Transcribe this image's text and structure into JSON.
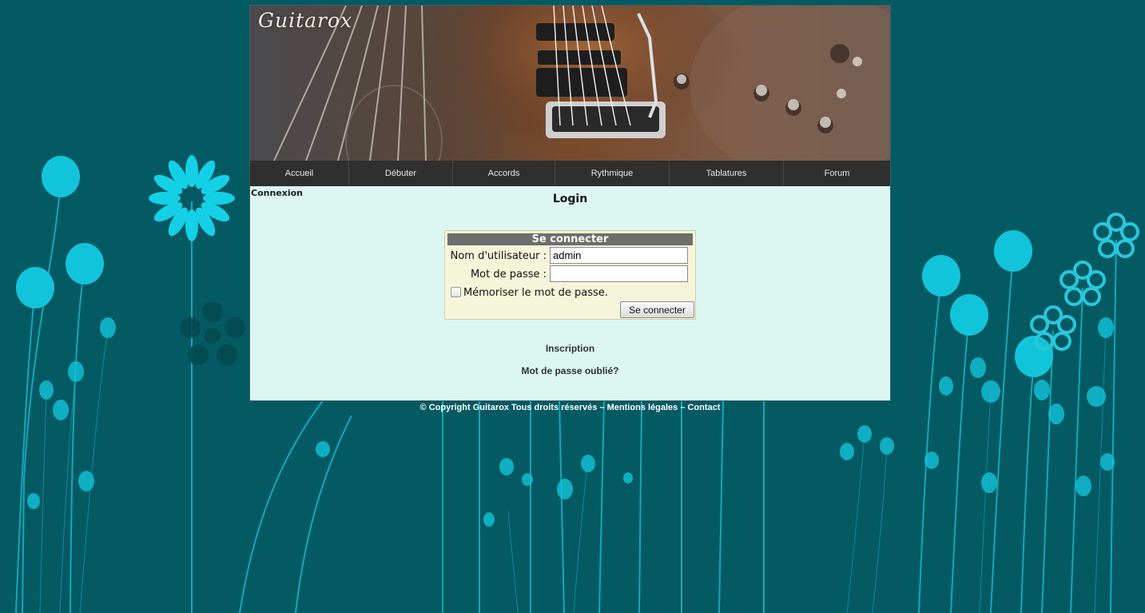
{
  "site": {
    "title": "Guitarox"
  },
  "nav": {
    "items": [
      {
        "label": "Accueil"
      },
      {
        "label": "Débuter"
      },
      {
        "label": "Accords"
      },
      {
        "label": "Rythmique"
      },
      {
        "label": "Tablatures"
      },
      {
        "label": "Forum"
      }
    ]
  },
  "sidebar": {
    "title": "Connexion"
  },
  "main": {
    "title": "Login"
  },
  "login_form": {
    "header": "Se connecter",
    "username_label": "Nom d'utilisateur :",
    "username_value": "admin",
    "password_label": "Mot de passe :",
    "password_value": "",
    "remember_label": "Mémoriser le mot de passe.",
    "remember_checked": false,
    "submit_label": "Se connecter"
  },
  "links": {
    "inscription": "Inscription",
    "forgot_password": "Mot de passe oublié?"
  },
  "footer": {
    "copyright": "© Copyright Guitarox Tous droits réservés",
    "separator": " – ",
    "legal": "Mentions légales",
    "contact": "Contact"
  },
  "colors": {
    "background": "#045a63",
    "flower": "#12c4da",
    "content_bg": "#dcf6f1",
    "nav_bg": "#2f2f2f",
    "form_bg": "#f5f5da",
    "form_header": "#6e6e6e"
  },
  "icons": [
    "checkbox-icon",
    "flower-decoration",
    "guitar-banner-image"
  ]
}
